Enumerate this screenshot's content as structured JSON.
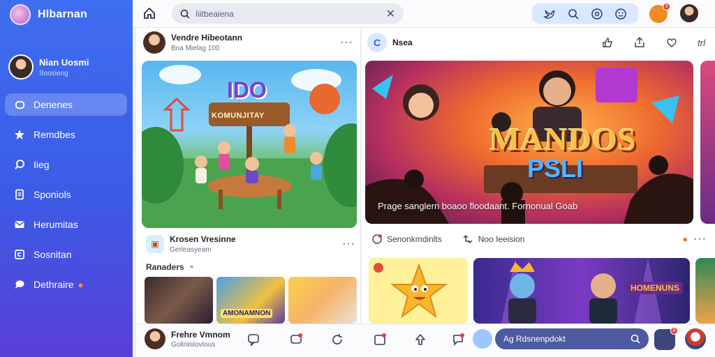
{
  "app": {
    "name": "Hlbarnan"
  },
  "profile": {
    "name": "Nian Uosmi",
    "subtitle": "Soosieng"
  },
  "sidebar": {
    "items": [
      {
        "label": "Denenes",
        "icon": "home-icon",
        "active": true
      },
      {
        "label": "Remdbes",
        "icon": "star-icon"
      },
      {
        "label": "Iieg",
        "icon": "chat-icon"
      },
      {
        "label": "Sponiols",
        "icon": "document-icon"
      },
      {
        "label": "Herumitas",
        "icon": "mail-icon"
      },
      {
        "label": "Sosnitan",
        "icon": "calendar-icon"
      },
      {
        "label": "Dethraire",
        "icon": "speech-bubble-icon"
      }
    ]
  },
  "topbar": {
    "search_value": "Iiitbeaiena",
    "icons": [
      "home-icon",
      "search-icon",
      "close-icon",
      "twitter-icon",
      "zoom-icon",
      "target-icon",
      "emoji-icon"
    ],
    "notification_count": "9"
  },
  "feed_left": {
    "post": {
      "name": "Vendre Hibeotann",
      "meta": "Bna Mielag 100"
    },
    "image_title": "IDO",
    "image_banner": "KOMUNJITAY",
    "sub_name": "Krosen Vresinne",
    "sub_meta": "Gerleasyeam",
    "section_label": "Ranaders",
    "thumb_labels": [
      "",
      "AMONAMNON",
      ""
    ]
  },
  "feed_right": {
    "post": {
      "name": "Nsea",
      "actions": [
        "like-icon",
        "share-icon",
        "heart-icon",
        "tril-icon"
      ],
      "action_text": "trl"
    },
    "image_title": "MANDOS",
    "image_subtitle": "PSLI",
    "caption": "Prage sanglern boaoo floodaant. Fornonual Goab",
    "reactions": [
      {
        "label": "Senonkmdinlts",
        "icon": "comment-icon"
      },
      {
        "label": "Noo Ieeision",
        "icon": "retweet-icon"
      }
    ],
    "card_stage_label": "HOMENUNS"
  },
  "bottombar": {
    "user": {
      "name": "Frehre Vmnom",
      "subtitle": "Goliraslovtous"
    },
    "icons": [
      "comment-icon",
      "message-icon",
      "refresh-icon",
      "calendar-icon",
      "upload-icon",
      "bubble-icon"
    ],
    "badges": [
      "",
      "1",
      "",
      "1",
      "",
      "1"
    ],
    "compose_value": "Ag Rdsnenpdokt",
    "compose_badge": "8"
  },
  "colors": {
    "sidebar_top": "#3f6ef0",
    "sidebar_bottom": "#5a3fd6",
    "accent": "#3b5be6",
    "badge": "#e43b3b"
  }
}
